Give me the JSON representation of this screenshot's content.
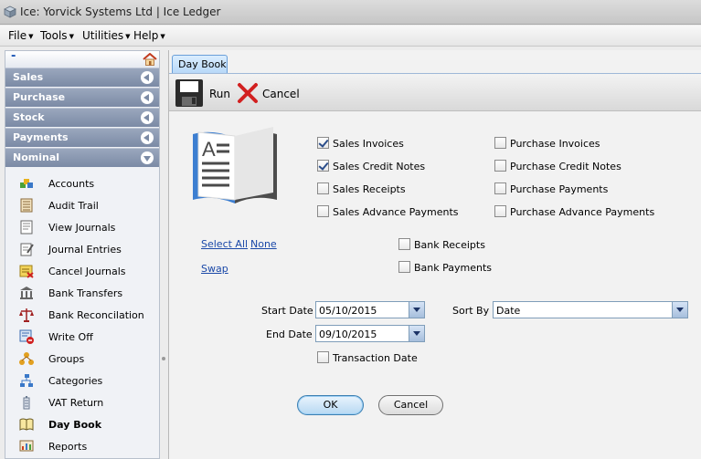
{
  "window": {
    "title": "Ice: Yorvick Systems Ltd | Ice Ledger"
  },
  "menu": {
    "items": [
      "File",
      "Tools",
      "Utilities",
      "Help"
    ]
  },
  "sidebar": {
    "collapse_label": "-",
    "sections": [
      "Sales",
      "Purchase",
      "Stock",
      "Payments",
      "Nominal"
    ],
    "items": [
      {
        "label": "Accounts",
        "icon": "accounts-icon"
      },
      {
        "label": "Audit Trail",
        "icon": "audit-trail-icon"
      },
      {
        "label": "View Journals",
        "icon": "view-journals-icon"
      },
      {
        "label": "Journal Entries",
        "icon": "journal-entries-icon"
      },
      {
        "label": "Cancel Journals",
        "icon": "cancel-journals-icon"
      },
      {
        "label": "Bank Transfers",
        "icon": "bank-icon"
      },
      {
        "label": "Bank Reconcilation",
        "icon": "scales-icon"
      },
      {
        "label": "Write Off",
        "icon": "write-off-icon"
      },
      {
        "label": "Groups",
        "icon": "groups-icon"
      },
      {
        "label": "Categories",
        "icon": "categories-icon"
      },
      {
        "label": "VAT Return",
        "icon": "vat-return-icon"
      },
      {
        "label": "Day Book",
        "icon": "book-icon",
        "active": true
      },
      {
        "label": "Reports",
        "icon": "reports-icon"
      }
    ]
  },
  "tab": {
    "label": "Day Book"
  },
  "toolbar": {
    "run_label": "Run",
    "cancel_label": "Cancel"
  },
  "checkboxes": {
    "sales_invoices": {
      "label": "Sales Invoices",
      "checked": true
    },
    "sales_credit_notes": {
      "label": "Sales Credit Notes",
      "checked": true
    },
    "sales_receipts": {
      "label": "Sales Receipts",
      "checked": false
    },
    "sales_advance_payments": {
      "label": "Sales Advance Payments",
      "checked": false
    },
    "purchase_invoices": {
      "label": "Purchase Invoices",
      "checked": false
    },
    "purchase_credit_notes": {
      "label": "Purchase Credit Notes",
      "checked": false
    },
    "purchase_payments": {
      "label": "Purchase Payments",
      "checked": false
    },
    "purchase_advance_payments": {
      "label": "Purchase Advance Payments",
      "checked": false
    },
    "bank_receipts": {
      "label": "Bank Receipts",
      "checked": false
    },
    "bank_payments": {
      "label": "Bank Payments",
      "checked": false
    },
    "transaction_date": {
      "label": "Transaction Date",
      "checked": false
    }
  },
  "links": {
    "select_all": "Select All",
    "none": "None",
    "swap": "Swap"
  },
  "filters": {
    "start_date_label": "Start Date",
    "start_date": "05/10/2015",
    "end_date_label": "End Date",
    "end_date": "09/10/2015",
    "sort_by_label": "Sort By",
    "sort_by": "Date"
  },
  "buttons": {
    "ok": "OK",
    "cancel": "Cancel"
  },
  "colors": {
    "accent": "#7b8aa5",
    "link": "#1a48a8",
    "tab": "#b8d8f8"
  }
}
